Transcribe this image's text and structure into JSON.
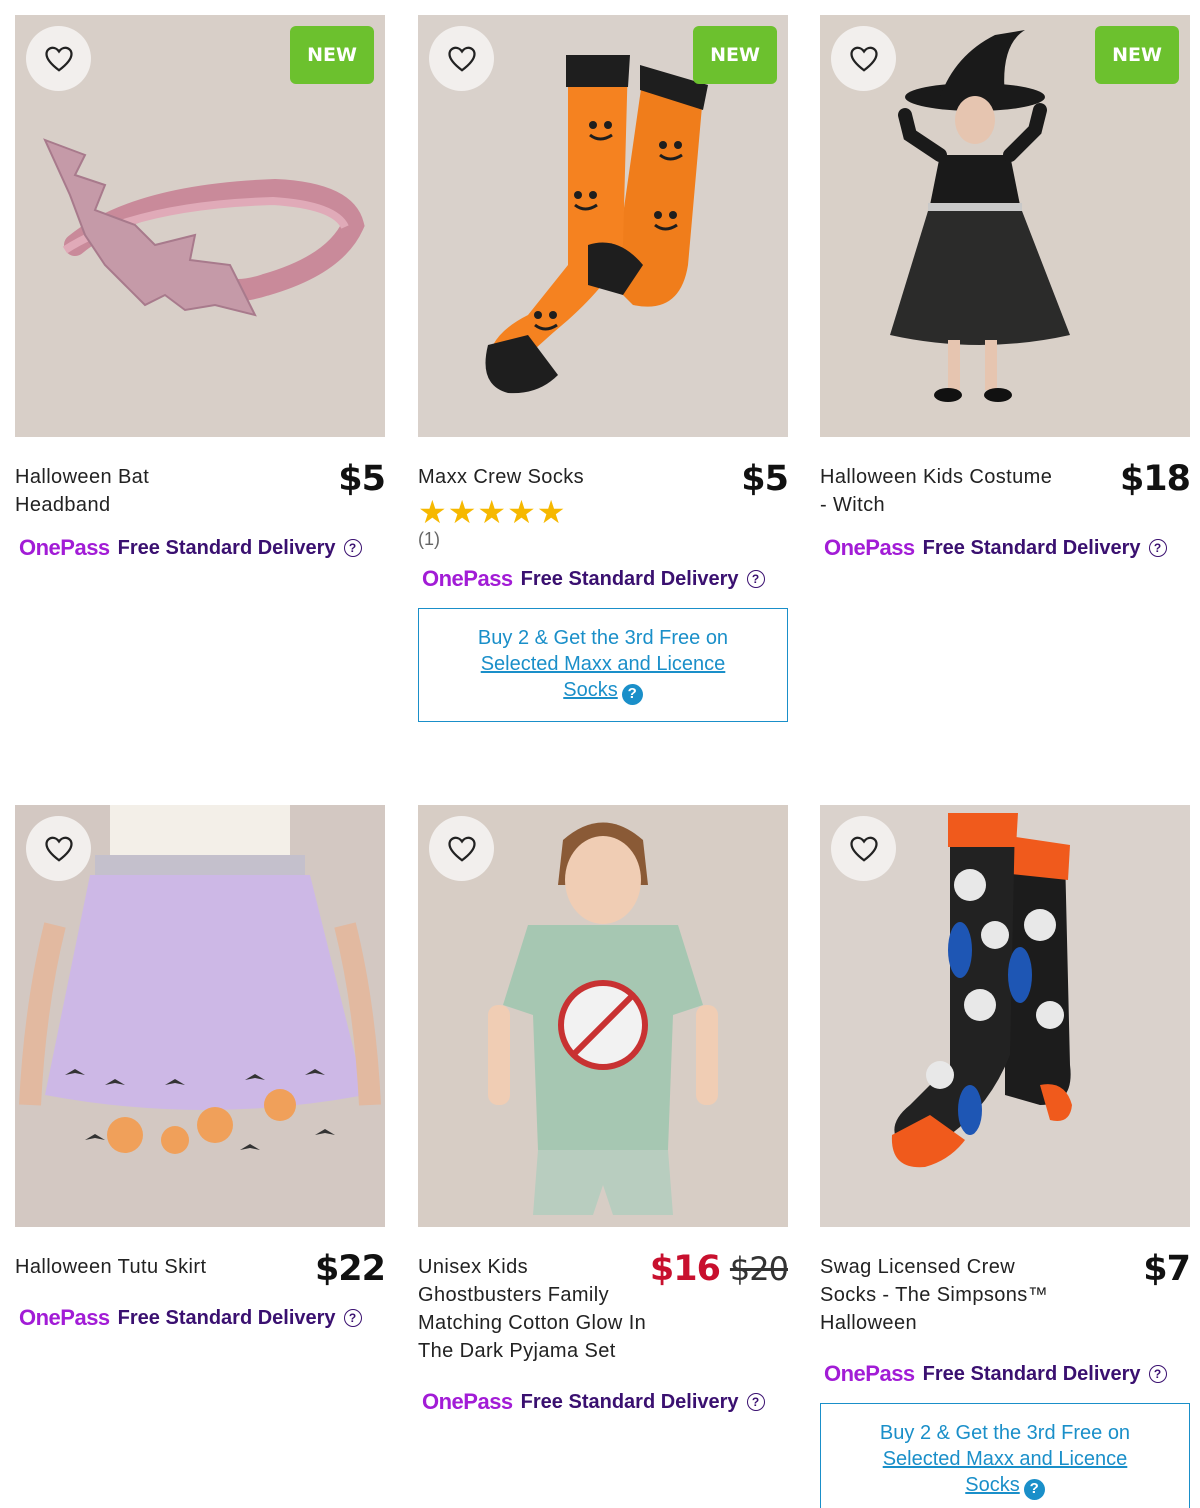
{
  "products": [
    {
      "title": "Halloween Bat Headband",
      "price": "$5",
      "badge": "NEW",
      "onepass_logo": "OnePass",
      "onepass_text": "Free Standard Delivery",
      "image_alt": "pink glitter bat headband"
    },
    {
      "title": "Maxx Crew Socks",
      "price": "$5",
      "badge": "NEW",
      "rating_stars": 5,
      "rating_count": "(1)",
      "onepass_logo": "OnePass",
      "onepass_text": "Free Standard Delivery",
      "promo": {
        "line1": "Buy 2 & Get the 3rd Free on",
        "line2": "Selected Maxx and Licence",
        "line3": "Socks"
      },
      "image_alt": "orange pumpkin socks"
    },
    {
      "title": "Halloween Kids Costume - Witch",
      "price": "$18",
      "badge": "NEW",
      "onepass_logo": "OnePass",
      "onepass_text": "Free Standard Delivery",
      "image_alt": "child in witch costume"
    },
    {
      "title": "Halloween Tutu Skirt",
      "price": "$22",
      "onepass_logo": "OnePass",
      "onepass_text": "Free Standard Delivery",
      "image_alt": "lilac tutu skirt with pumpkins"
    },
    {
      "title": "Unisex Kids Ghostbusters Family Matching Cotton Glow In The Dark Pyjama Set",
      "price": "$16",
      "price_was": "$20",
      "onepass_logo": "OnePass",
      "onepass_text": "Free Standard Delivery",
      "image_alt": "child in ghostbusters pyjamas"
    },
    {
      "title": "Swag Licensed Crew Socks - The Simpsons™ Halloween",
      "price": "$7",
      "onepass_logo": "OnePass",
      "onepass_text": "Free Standard Delivery",
      "promo": {
        "line1": "Buy 2 & Get the 3rd Free on",
        "line2": "Selected Maxx and Licence",
        "line3": "Socks"
      },
      "image_alt": "black simpsons halloween socks"
    }
  ],
  "icons": {
    "wishlist": "heart-outline-icon",
    "help": "question-circle-icon",
    "promo_help": "question-filled-icon"
  },
  "colors": {
    "new_badge": "#6cc12e",
    "onepass_purple": "#a21cd6",
    "delivery_text": "#3a1070",
    "promo_blue": "#1a8fc9",
    "sale_red": "#c8102e",
    "star_yellow": "#f6b800"
  }
}
